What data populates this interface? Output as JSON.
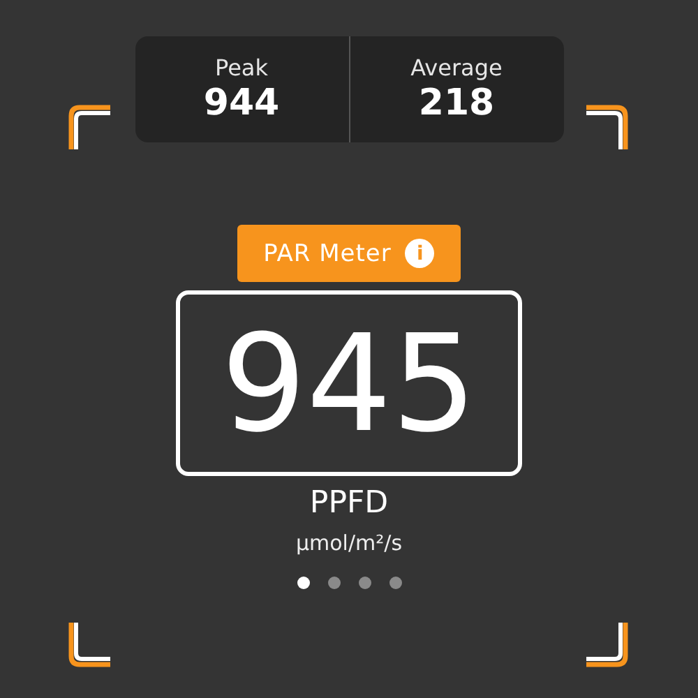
{
  "stats": [
    {
      "label": "Peak",
      "value": "944"
    },
    {
      "label": "Average",
      "value": "218"
    }
  ],
  "badge": {
    "label": "PAR Meter",
    "info_icon": "i"
  },
  "reading": {
    "value": "945",
    "quantity": "PPFD",
    "unit": "µmol/m²/s"
  },
  "pages": [
    {
      "selected": true
    },
    {
      "selected": false
    },
    {
      "selected": false
    },
    {
      "selected": false
    }
  ]
}
